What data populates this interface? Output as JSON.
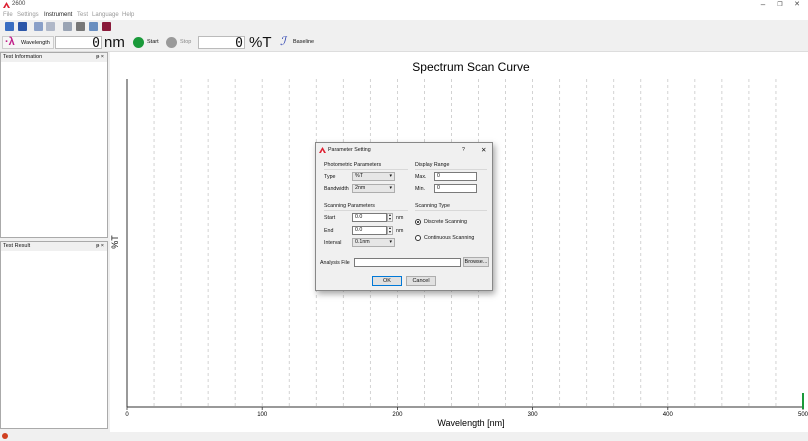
{
  "window": {
    "title": "2600",
    "minimize_glyph": "–",
    "restore_glyph": "❐",
    "close_glyph": "✕"
  },
  "menu": [
    "File",
    "Settings",
    "Instrument",
    "Test",
    "Language",
    "Help"
  ],
  "toolbar": {
    "wavelength_label": "Wavelength",
    "wavelength_value": "0",
    "wavelength_unit": "nm",
    "start_label": "Start",
    "stop_label": "Stop",
    "reading_value": "0",
    "reading_unit": "%T",
    "baseline_label": "Baseline"
  },
  "panels": {
    "test_information": "Test Information",
    "test_result": "Test Result",
    "pin_glyph": "ᵽ ×"
  },
  "chart_data": {
    "type": "line",
    "title": "Spectrum Scan Curve",
    "xlabel": "Wavelength [nm]",
    "ylabel": "%T",
    "xlim": [
      0,
      500
    ],
    "x_ticks": [
      0,
      100,
      200,
      300,
      400,
      500
    ],
    "grid": true,
    "series": []
  },
  "dialog": {
    "title": "Parameter Setting",
    "help_glyph": "?",
    "close_glyph": "✕",
    "photometric_header": "Photometric Parameters",
    "type_label": "Type",
    "type_value": "%T",
    "bandwidth_label": "Bandwidth",
    "bandwidth_value": "2nm",
    "display_header": "Display Range",
    "max_label": "Max.",
    "max_value": "0",
    "min_label": "Min.",
    "min_value": "0",
    "scanning_header": "Scanning Parameters",
    "start_label": "Start",
    "start_value": "0.0",
    "end_label": "End",
    "end_value": "0.0",
    "nm": "nm",
    "interval_label": "Interval",
    "interval_value": "0.1nm",
    "scan_type_header": "Scanning Type",
    "discrete_label": "Discrete Scanning",
    "continuous_label": "Continuous Scanning",
    "analysis_label": "Analysis File",
    "analysis_value": "",
    "browse_label": "Browse...",
    "ok_label": "OK",
    "cancel_label": "Cancel"
  },
  "colors": {
    "accent_green": "#1a9a3a",
    "stop_gray": "#9a9a9a",
    "wave_icon_magenta": "#c0208a",
    "baseline_blue": "#2a40b0"
  }
}
